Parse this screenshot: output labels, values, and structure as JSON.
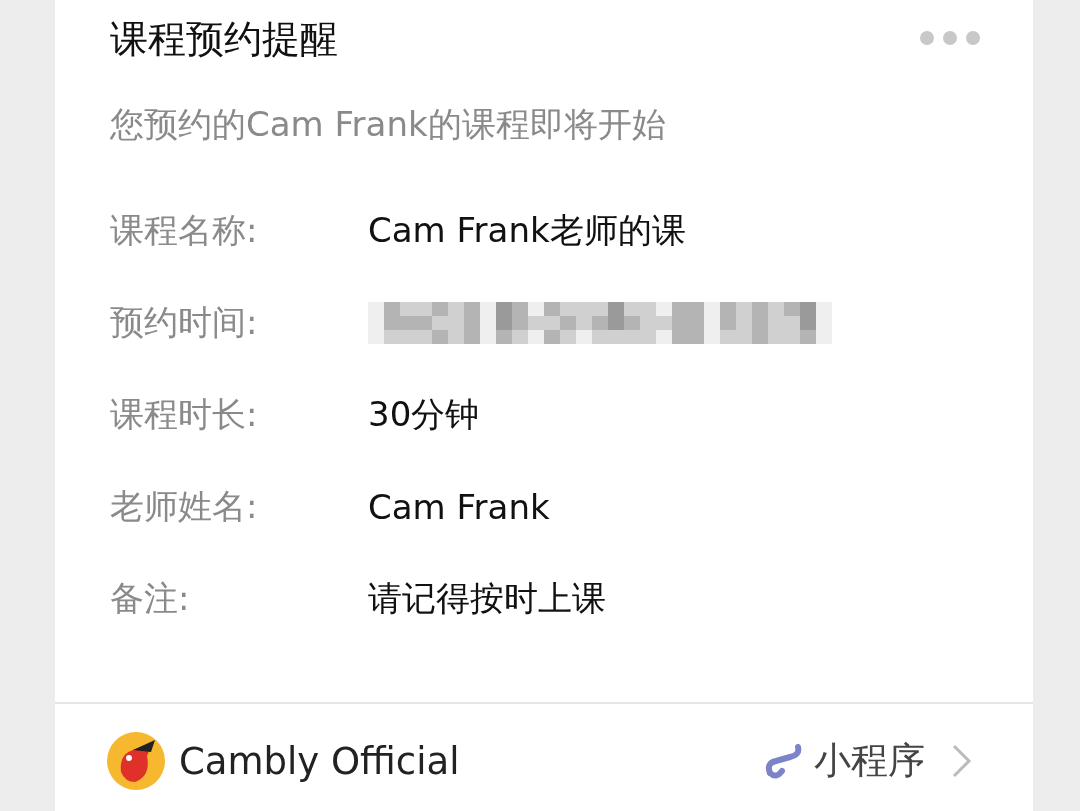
{
  "card": {
    "title": "课程预约提醒",
    "subtitle": "您预约的Cam Frank的课程即将开始",
    "fields": [
      {
        "kind": "text",
        "label": "课程名称:",
        "value": "Cam Frank老师的课"
      },
      {
        "kind": "redacted",
        "label": "预约时间:"
      },
      {
        "kind": "text",
        "label": "课程时长:",
        "value": "30分钟"
      },
      {
        "kind": "text",
        "label": "老师姓名:",
        "value": "Cam Frank"
      },
      {
        "kind": "text",
        "label": "备注:",
        "value": "请记得按时上课"
      }
    ],
    "footer": {
      "account": "Cambly Official",
      "source": "小程序"
    }
  }
}
